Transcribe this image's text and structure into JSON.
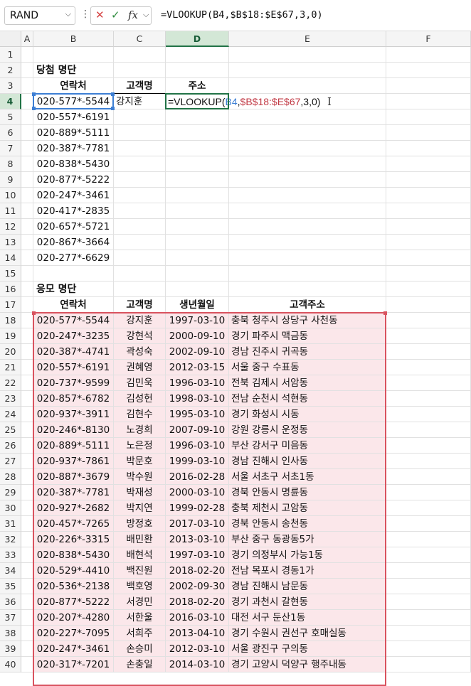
{
  "formula_bar": {
    "name_box": "RAND",
    "cancel_icon": "✕",
    "enter_icon": "✓",
    "fx_label": "fx",
    "formula": "=VLOOKUP(B4,$B$18:$E$67,3,0)"
  },
  "columns": [
    "A",
    "B",
    "C",
    "D",
    "E",
    "F"
  ],
  "rows": [
    "1",
    "2",
    "3",
    "4",
    "5",
    "6",
    "7",
    "8",
    "9",
    "10",
    "11",
    "12",
    "13",
    "14",
    "15",
    "16",
    "17",
    "18",
    "19",
    "20",
    "21",
    "22",
    "23",
    "24",
    "25",
    "26",
    "27",
    "28",
    "29",
    "30",
    "31",
    "32",
    "33",
    "34",
    "35",
    "36",
    "37",
    "38",
    "39",
    "40"
  ],
  "winners": {
    "title": "당첨 명단",
    "headers": [
      "연락처",
      "고객명",
      "주소"
    ],
    "first_name": "강지훈",
    "edit_formula": {
      "prefix": "=VLOOKUP(",
      "ref1": "B4",
      "sep1": ",",
      "ref2": "$B$18:$E$67",
      "suffix": ",3,0)"
    },
    "phones": [
      "020-577*-5544",
      "020-557*-6191",
      "020-889*-5111",
      "020-387*-7781",
      "020-838*-5430",
      "020-877*-5222",
      "020-247*-3461",
      "020-417*-2835",
      "020-657*-5721",
      "020-867*-3664",
      "020-277*-6629"
    ]
  },
  "applicants": {
    "title": "응모 명단",
    "headers": [
      "연락처",
      "고객명",
      "생년월일",
      "고객주소"
    ],
    "rows": [
      [
        "020-577*-5544",
        "강지훈",
        "1997-03-10",
        "충북 청주시 상당구 사천동"
      ],
      [
        "020-247*-3235",
        "강현석",
        "2000-09-10",
        "경기 파주시 맥금동"
      ],
      [
        "020-387*-4741",
        "곽성숙",
        "2002-09-10",
        "경남 진주시 귀곡동"
      ],
      [
        "020-557*-6191",
        "권혜영",
        "2012-03-15",
        "서울 중구 수표동"
      ],
      [
        "020-737*-9599",
        "김민욱",
        "1996-03-10",
        "전북 김제시 서암동"
      ],
      [
        "020-857*-6782",
        "김성헌",
        "1998-03-10",
        "전남 순천시 석현동"
      ],
      [
        "020-937*-3911",
        "김현수",
        "1995-03-10",
        "경기 화성시 시동"
      ],
      [
        "020-246*-8130",
        "노경희",
        "2007-09-10",
        "강원 강릉시 운정동"
      ],
      [
        "020-889*-5111",
        "노은정",
        "1996-03-10",
        "부산 강서구 미음동"
      ],
      [
        "020-937*-7861",
        "박문호",
        "1999-03-10",
        "경남 진해시 인사동"
      ],
      [
        "020-887*-3679",
        "박수원",
        "2016-02-28",
        "서울 서초구 서초1동"
      ],
      [
        "020-387*-7781",
        "박재성",
        "2000-03-10",
        "경북 안동시 명륜동"
      ],
      [
        "020-927*-2682",
        "박지연",
        "1999-02-28",
        "충북 제천시 고암동"
      ],
      [
        "020-457*-7265",
        "방정호",
        "2017-03-10",
        "경북 안동시 송천동"
      ],
      [
        "020-226*-3315",
        "배민환",
        "2013-03-10",
        "부산 중구 동광동5가"
      ],
      [
        "020-838*-5430",
        "배현석",
        "1997-03-10",
        "경기 의정부시 가능1동"
      ],
      [
        "020-529*-4410",
        "백진원",
        "2018-02-20",
        "전남 목포시 경동1가"
      ],
      [
        "020-536*-2138",
        "백호영",
        "2002-09-30",
        "경남 진해시 남문동"
      ],
      [
        "020-877*-5222",
        "서경민",
        "2018-02-20",
        "경기 과천시 갈현동"
      ],
      [
        "020-207*-4280",
        "서한울",
        "2016-03-10",
        "대전 서구 둔산1동"
      ],
      [
        "020-227*-7095",
        "서희주",
        "2013-04-10",
        "경기 수원시 권선구 호매실동"
      ],
      [
        "020-247*-3461",
        "손승미",
        "2012-03-10",
        "서울 광진구 구의동"
      ],
      [
        "020-317*-7201",
        "손충일",
        "2014-03-10",
        "경기 고양시 덕양구 행주내동"
      ]
    ]
  }
}
